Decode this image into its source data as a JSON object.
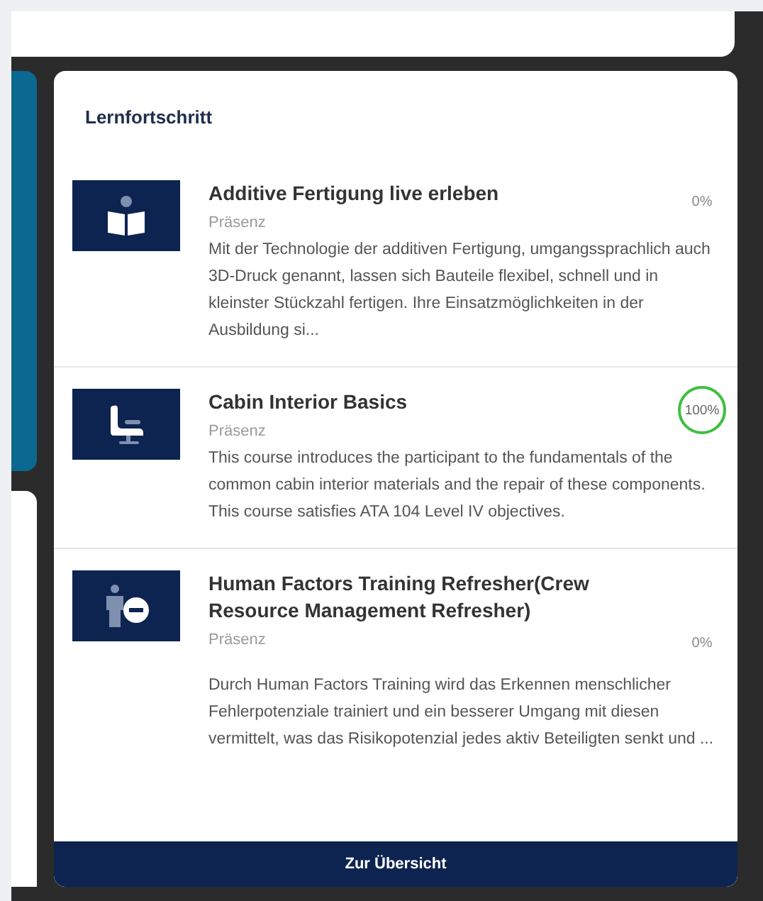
{
  "panel": {
    "title": "Lernfortschritt",
    "courses": [
      {
        "title": "Additive Fertigung live erleben",
        "type": "Präsenz",
        "description": "Mit der Technologie der additiven Fertigung, umgangssprachlich auch 3D-Druck genannt, lassen sich Bauteile flexibel, schnell und in kleinster Stückzahl fertigen. Ihre Einsatzmöglichkeiten in der Ausbildung si...",
        "progress": "0%",
        "completed": false
      },
      {
        "title": "Cabin Interior Basics",
        "type": "Präsenz",
        "description": "This course introduces the participant to the fundamentals of the common cabin interior materials and the repair of these components. This course satisfies ATA 104 Level IV objectives.",
        "progress": "100%",
        "completed": true
      },
      {
        "title": "Human Factors Training Refresher(Crew Resource Management Refresher)",
        "type": "Präsenz",
        "description": "Durch Human Factors Training wird das Erkennen menschlicher Fehlerpotenziale trainiert und ein besserer Umgang mit diesen vermittelt, was das Risikopotenzial jedes aktiv Beteiligten senkt und ...",
        "progress": "0%",
        "completed": false
      }
    ],
    "button": "Zur Übersicht"
  }
}
